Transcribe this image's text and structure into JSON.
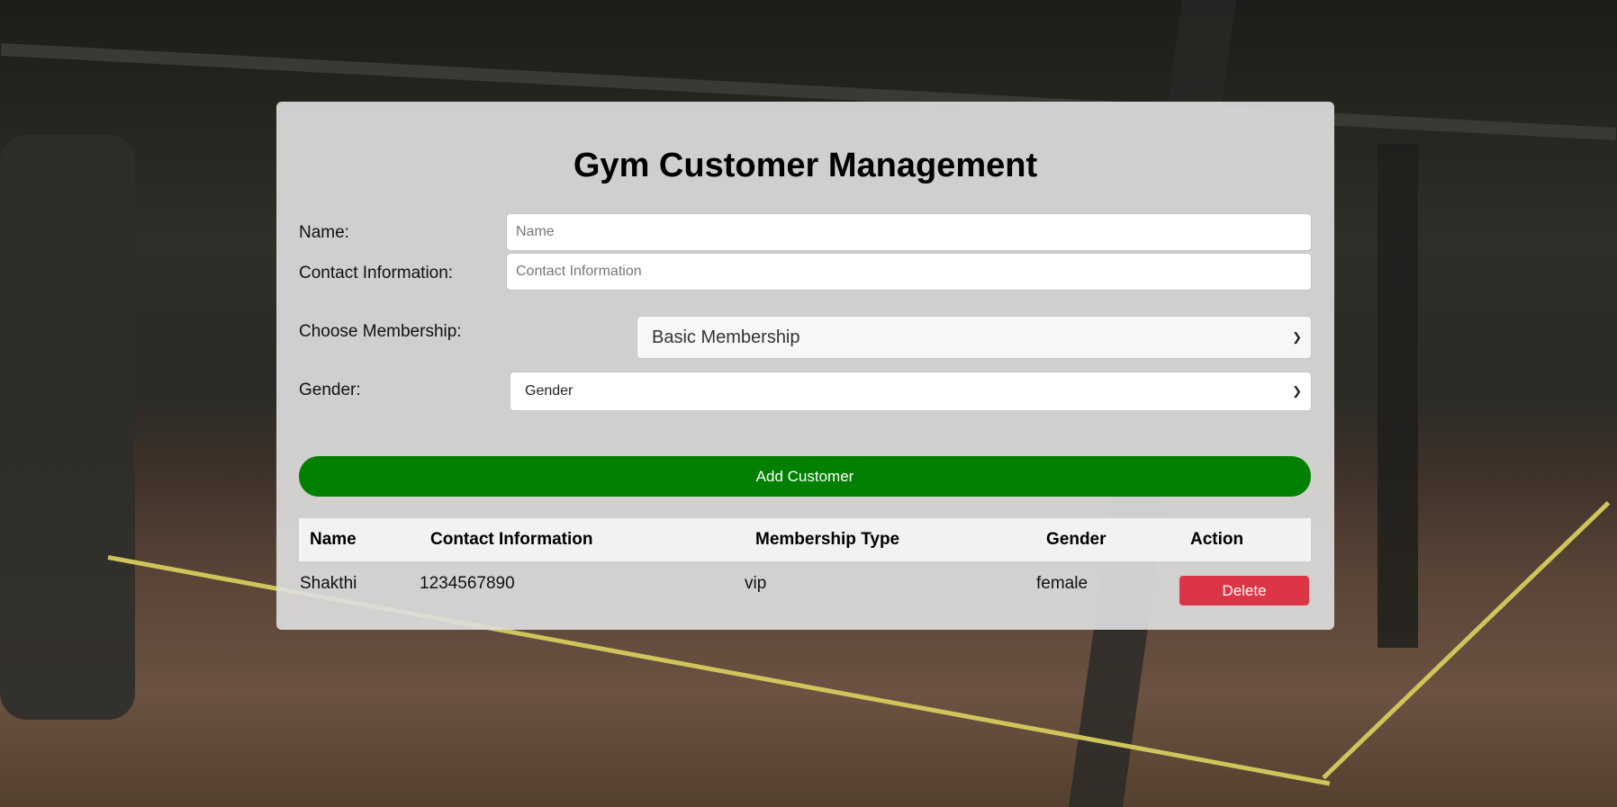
{
  "page": {
    "title": "Gym Customer Management"
  },
  "form": {
    "name_label": "Name:",
    "name_placeholder": "Name",
    "name_value": "",
    "contact_label": "Contact Information:",
    "contact_placeholder": "Contact Information",
    "contact_value": "",
    "membership_label": "Choose Membership:",
    "membership_selected": "Basic Membership",
    "gender_label": "Gender:",
    "gender_selected": "Gender",
    "add_button_label": "Add Customer"
  },
  "table": {
    "headers": [
      "Name",
      "Contact Information",
      "Membership Type",
      "Gender",
      "Action"
    ],
    "rows": [
      {
        "name": "Shakthi",
        "contact": "1234567890",
        "membership": "vip",
        "gender": "female",
        "action_label": "Delete"
      }
    ]
  },
  "colors": {
    "add_button": "#018001",
    "delete_button": "#dc3545",
    "panel_bg": "#dddddd"
  },
  "icons": {
    "select_arrow": "chevron-down-icon"
  }
}
